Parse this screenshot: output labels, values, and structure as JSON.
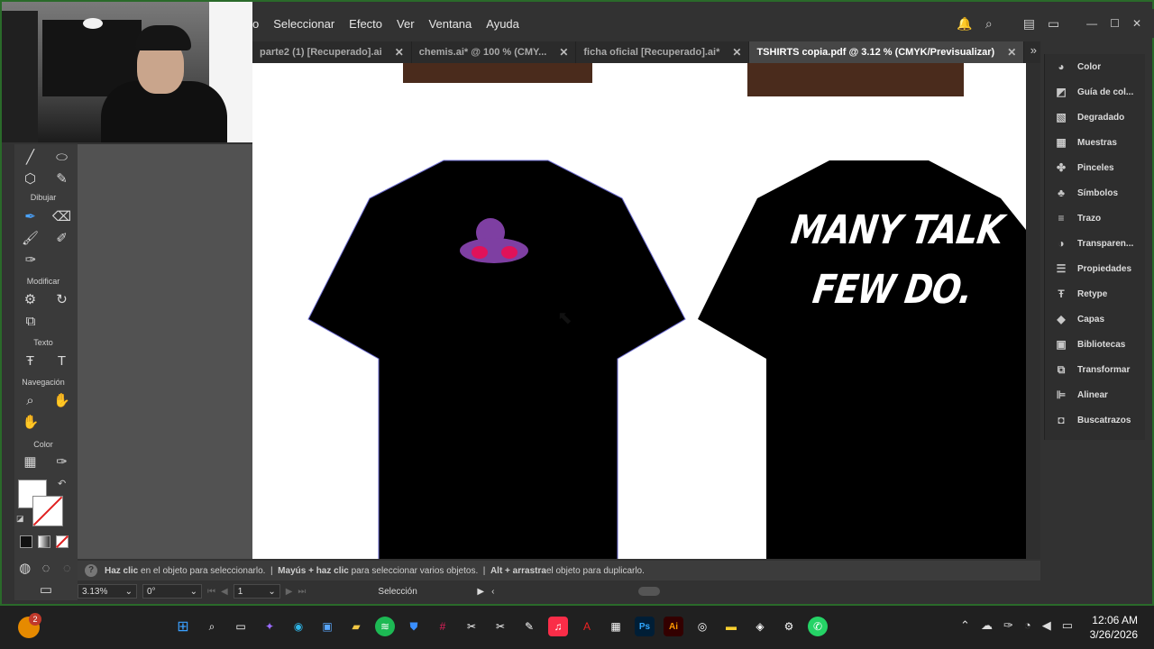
{
  "menubar": {
    "items": [
      "o",
      "Seleccionar",
      "Efecto",
      "Ver",
      "Ventana",
      "Ayuda"
    ],
    "right_icons": [
      "bell-icon",
      "search-icon",
      "layout-icon",
      "window-icon"
    ]
  },
  "window_controls": {
    "minimize": "—",
    "maximize": "☐",
    "close": "✕"
  },
  "tabs": [
    {
      "label": "parte2  (1) [Recuperado].ai",
      "active": false
    },
    {
      "label": "chemis.ai* @ 100 % (CMY...",
      "active": false
    },
    {
      "label": "ficha oficial [Recuperado].ai*",
      "active": false
    },
    {
      "label": "TSHIRTS copia.pdf @ 3.12 % (CMYK/Previsualizar)",
      "active": true
    }
  ],
  "tools": {
    "labels": {
      "draw": "Dibujar",
      "modify": "Modificar",
      "text": "Texto",
      "navigation": "Navegación",
      "color": "Color"
    }
  },
  "canvas": {
    "shirt_back_text_line1": "MANY TALK",
    "shirt_back_text_line2": "FEW DO.",
    "shirt_color": "#000000",
    "logo_color": "#7e3fa2",
    "eyes_color": "#e0125a"
  },
  "statusbar": {
    "help": "?",
    "part1_bold": "Haz clic",
    "part1": " en el objeto para seleccionarlo.  |  ",
    "part2_bold": "Mayús + haz clic",
    "part2": " para seleccionar varios objetos.  |  ",
    "part3_bold": "Alt + arrastra",
    "part3": " el objeto para duplicarlo."
  },
  "bottombar": {
    "zoom": "3.13%",
    "rotation": "0°",
    "artboard": "1",
    "tool": "Selección"
  },
  "rightpanel": {
    "items": [
      {
        "label": "Color",
        "icon": "color-icon"
      },
      {
        "label": "Guía de col...",
        "icon": "color-guide-icon"
      },
      {
        "label": "Degradado",
        "icon": "gradient-icon"
      },
      {
        "label": "Muestras",
        "icon": "swatches-icon"
      },
      {
        "label": "Pinceles",
        "icon": "brushes-icon"
      },
      {
        "label": "Símbolos",
        "icon": "symbols-icon"
      },
      {
        "label": "Trazo",
        "icon": "stroke-icon"
      },
      {
        "label": "Transparen...",
        "icon": "transparency-icon"
      },
      {
        "label": "Propiedades",
        "icon": "properties-icon"
      },
      {
        "label": "Retype",
        "icon": "retype-icon"
      },
      {
        "label": "Capas",
        "icon": "layers-icon"
      },
      {
        "label": "Bibliotecas",
        "icon": "libraries-icon"
      },
      {
        "label": "Transformar",
        "icon": "transform-icon"
      },
      {
        "label": "Alinear",
        "icon": "align-icon"
      },
      {
        "label": "Buscatrazos",
        "icon": "pathfinder-icon"
      }
    ]
  },
  "taskbar": {
    "badge": "2",
    "time": "12:06 AM",
    "date": "3/26/2026"
  }
}
